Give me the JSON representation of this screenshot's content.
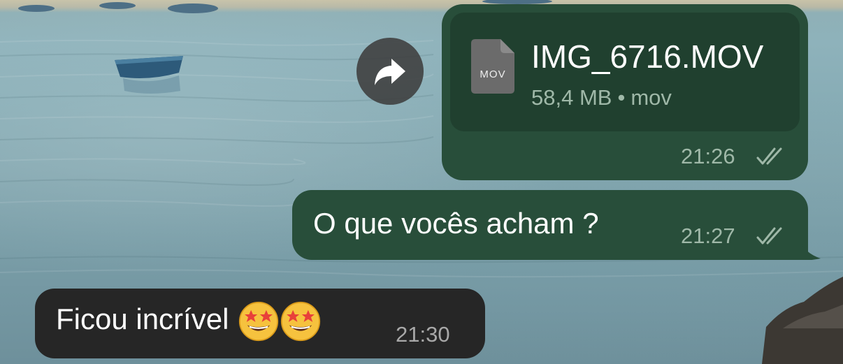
{
  "chat": {
    "file_message": {
      "file_name": "IMG_6716.MOV",
      "file_icon_label": "MOV",
      "file_size": "58,4 MB",
      "file_type": "mov",
      "separator": "•",
      "time": "21:26",
      "status": "read"
    },
    "text_message_out": {
      "text": "O que vocês acham ?",
      "time": "21:27",
      "status": "read"
    },
    "text_message_in": {
      "text": "Ficou incrível",
      "emoji": [
        "star-struck",
        "star-struck"
      ],
      "time": "21:30"
    },
    "forward_icon": "forward-arrow-icon"
  },
  "colors": {
    "outgoing_bubble": "#284e3a",
    "file_card": "#20402f",
    "incoming_bubble": "#262626",
    "meta_text_out": "#9fb8a8",
    "meta_text_in": "#a8a8a8"
  }
}
